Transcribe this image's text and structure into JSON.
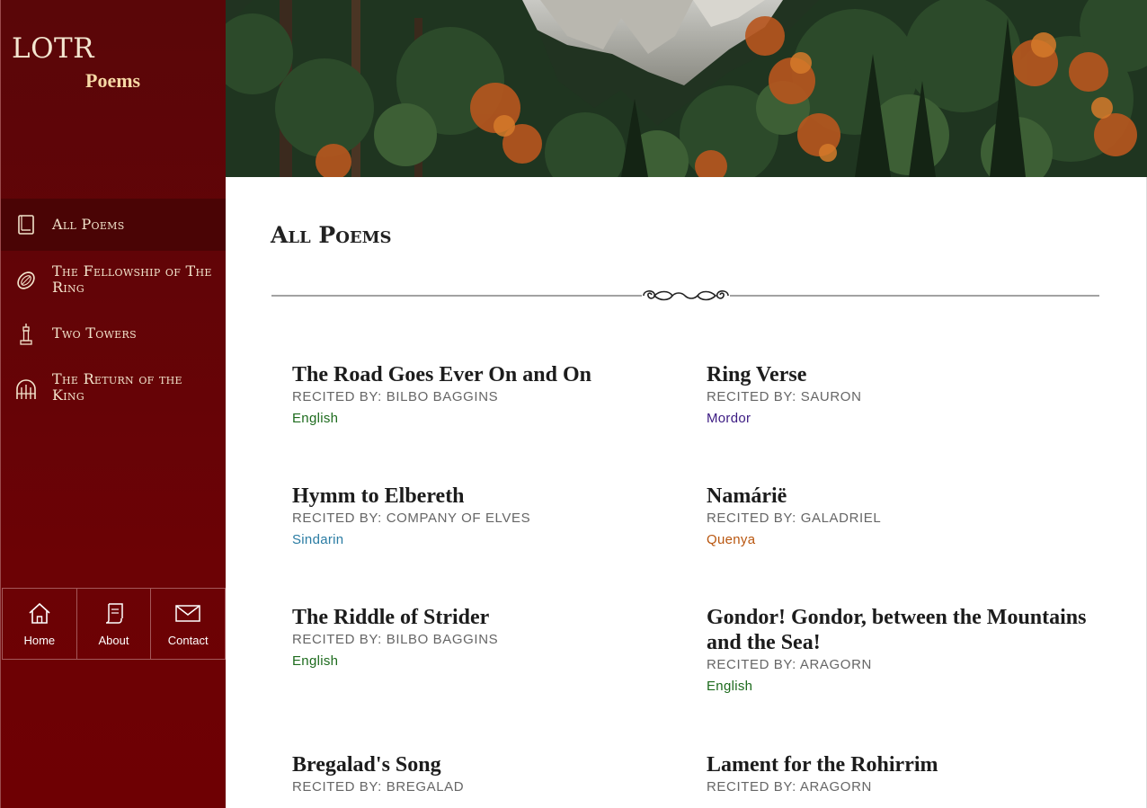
{
  "brand": {
    "title": "LOTR",
    "subtitle": "Poems"
  },
  "nav": {
    "items": [
      {
        "label": "All Poems",
        "icon": "book-icon",
        "active": true
      },
      {
        "label": "The Fellowship of The Ring",
        "icon": "ring-icon",
        "active": false
      },
      {
        "label": "Two Towers",
        "icon": "tower-icon",
        "active": false
      },
      {
        "label": "The Return of the King",
        "icon": "gate-icon",
        "active": false
      }
    ]
  },
  "bottom_nav": {
    "home": "Home",
    "about": "About",
    "contact": "Contact"
  },
  "hero": {
    "image": "forest-mountain-photo"
  },
  "main": {
    "title": "All Poems",
    "divider_icon": "flourish-ornament-icon"
  },
  "poems": [
    {
      "title": "The Road Goes Ever On and On",
      "recited_by": "RECITED BY: BILBO BAGGINS",
      "language": "English",
      "color": "#1d6b1d"
    },
    {
      "title": "Ring Verse",
      "recited_by": "RECITED BY: SAURON",
      "language": "Mordor",
      "color": "#3b1a82"
    },
    {
      "title": "Hymm to Elbereth",
      "recited_by": "RECITED BY: COMPANY OF ELVES",
      "language": "Sindarin",
      "color": "#2a7ca3"
    },
    {
      "title": "Namárië",
      "recited_by": "RECITED BY: GALADRIEL",
      "language": "Quenya",
      "color": "#b9560f"
    },
    {
      "title": "The Riddle of Strider",
      "recited_by": "RECITED BY: BILBO BAGGINS",
      "language": "English",
      "color": "#1d6b1d"
    },
    {
      "title": "Gondor! Gondor, between the Mountains and the Sea!",
      "recited_by": "RECITED BY: ARAGORN",
      "language": "English",
      "color": "#1d6b1d"
    },
    {
      "title": "Bregalad's Song",
      "recited_by": "RECITED BY: BREGALAD",
      "language": "",
      "color": "#1d6b1d"
    },
    {
      "title": "Lament for the Rohirrim",
      "recited_by": "RECITED BY: ARAGORN",
      "language": "",
      "color": "#1d6b1d"
    }
  ],
  "colors": {
    "sidebar": "#6a0205",
    "sidebar_active": "#4a0405",
    "brand_text": "#f4e6d0"
  }
}
